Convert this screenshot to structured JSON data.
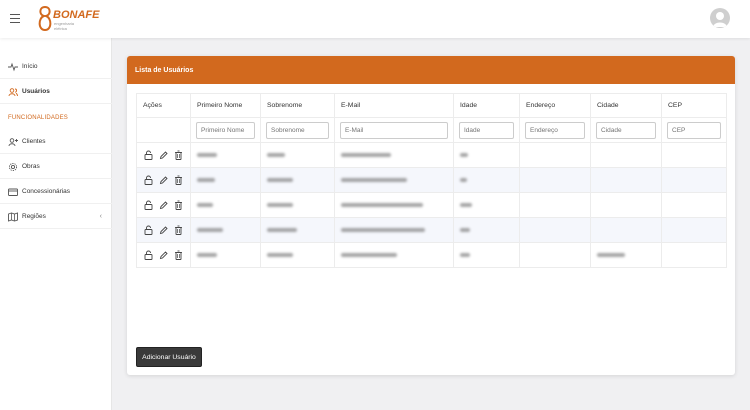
{
  "brand": {
    "name": "BONAFE",
    "tagline": "engenharia elétrica",
    "color": "#d2691e"
  },
  "sidebar": {
    "items": [
      {
        "label": "Início",
        "icon": "activity-icon"
      },
      {
        "label": "Usuários",
        "icon": "users-icon"
      },
      {
        "label": "Clientes",
        "icon": "user-plus-icon"
      },
      {
        "label": "Obras",
        "icon": "settings-icon"
      },
      {
        "label": "Concessionárias",
        "icon": "credit-card-icon"
      },
      {
        "label": "Regiões",
        "icon": "map-icon"
      }
    ],
    "section_heading": "FUNCIONALIDADES",
    "regioes_chevron": "‹"
  },
  "card": {
    "title": "Lista de Usuários",
    "columns": [
      "Ações",
      "Primeiro Nome",
      "Sobrenome",
      "E-Mail",
      "Idade",
      "Endereço",
      "Cidade",
      "CEP"
    ],
    "filters": {
      "primeiro_nome": "Primeiro Nome",
      "sobrenome": "Sobrenome",
      "email": "E-Mail",
      "idade": "Idade",
      "endereco": "Endereço",
      "cidade": "Cidade",
      "cep": "CEP"
    },
    "row_count": 5,
    "add_button": "Adicionar Usuário"
  }
}
